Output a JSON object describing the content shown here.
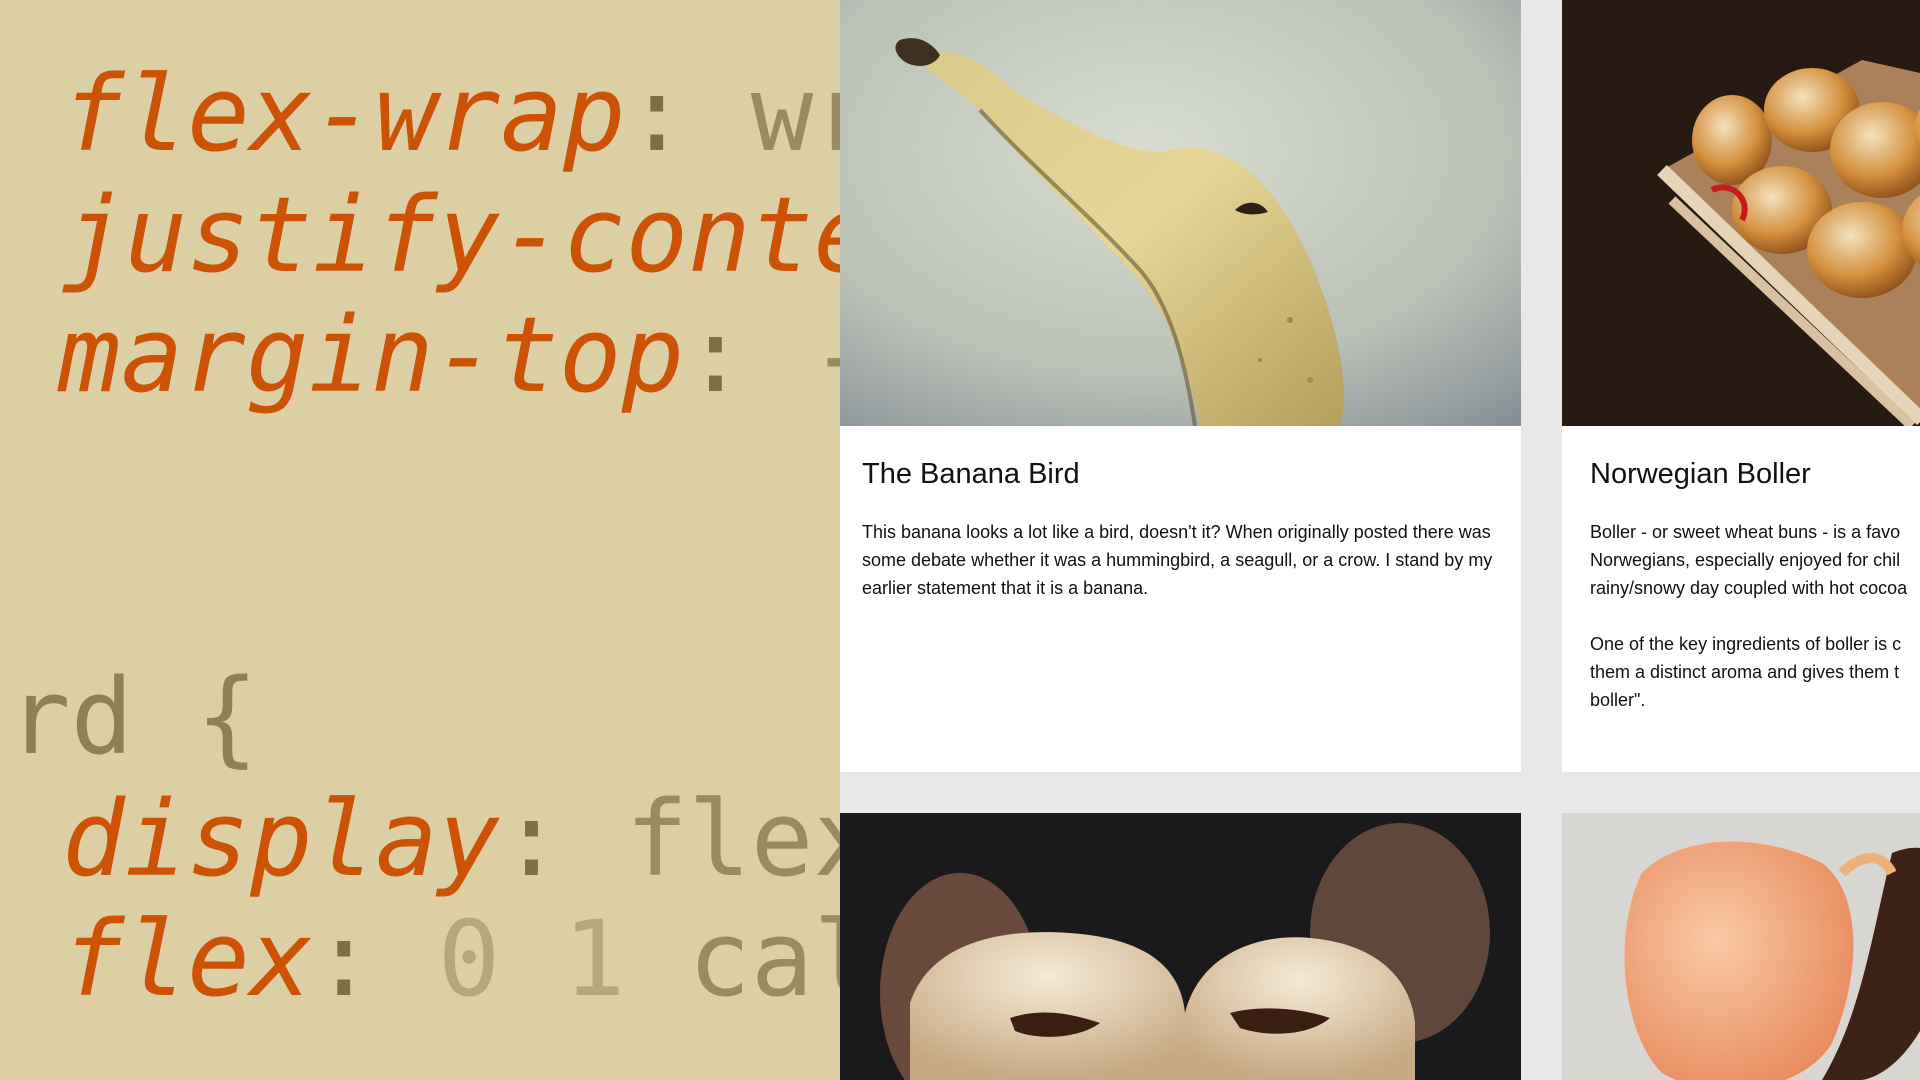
{
  "code": {
    "lines": [
      {
        "prop": "flex-wrap",
        "colon": ":",
        "value": " wr"
      },
      {
        "prop": "justify-conte",
        "colon": "",
        "value": ""
      },
      {
        "prop": "margin-top",
        "colon": ":",
        "value": " -"
      },
      {
        "selector": "rd {"
      },
      {
        "prop": "display",
        "colon": ":",
        "value": " flex"
      },
      {
        "prop": "flex",
        "colon": ":",
        "num": " 0 1",
        "value": " cal"
      }
    ]
  },
  "cards": [
    {
      "title": "The Banana Bird",
      "paragraphs": [
        "This banana looks a lot like a bird, doesn't it? When originally posted there was some debate whether it was a hummingbird, a seagull, or a crow. I stand by my earlier statement that it is a banana."
      ]
    },
    {
      "title": "Norwegian Boller",
      "paragraphs": [
        "Boller - or sweet wheat buns - is a favo Norwegians, especially enjoyed for chil rainy/snowy day coupled with hot cocoa",
        "One of the key ingredients of boller is c them a distinct aroma and gives them t boller\"."
      ]
    },
    {
      "title": "",
      "paragraphs": []
    },
    {
      "title": "",
      "paragraphs": []
    }
  ],
  "colors": {
    "code_bg": "#dccfa3",
    "code_property": "#cc5206",
    "grid_bg": "#e8e8e8",
    "card_bg": "#ffffff"
  }
}
